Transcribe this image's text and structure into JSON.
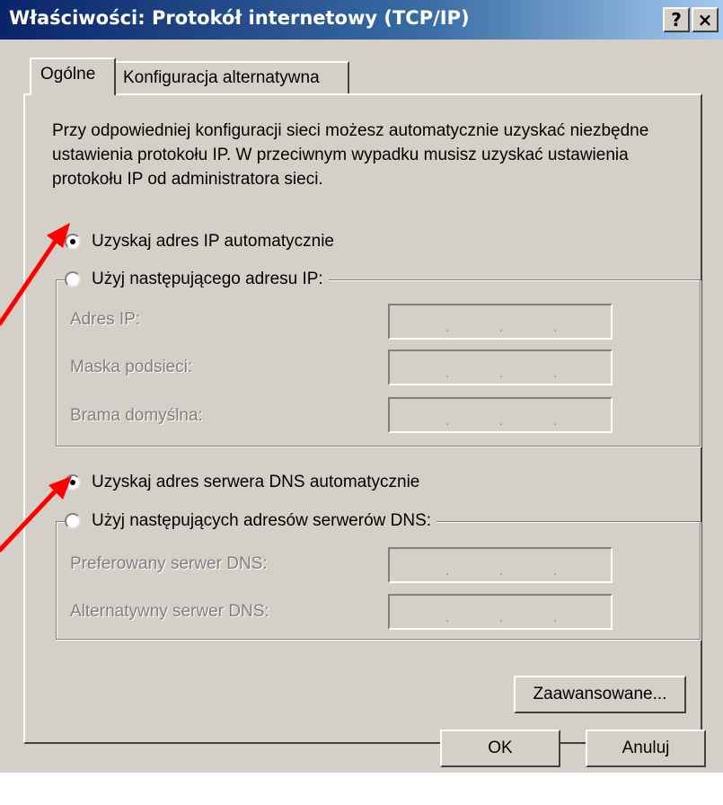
{
  "window": {
    "title": "Właściwości: Protokół internetowy (TCP/IP)",
    "help_button": "?",
    "close_button": "×"
  },
  "tabs": [
    {
      "label": "Ogólne",
      "active": true
    },
    {
      "label": "Konfiguracja alternatywna",
      "active": false
    }
  ],
  "description": "Przy odpowiedniej konfiguracji sieci możesz automatycznie uzyskać niezbędne ustawienia protokołu IP. W przeciwnym wypadku musisz uzyskać ustawienia protokołu IP od administratora sieci.",
  "ip": {
    "auto_label": "Uzyskaj adres IP automatycznie",
    "auto_checked": true,
    "manual_label": "Użyj następującego adresu IP:",
    "fields": [
      {
        "label": "Adres IP:",
        "value": ". . ."
      },
      {
        "label": "Maska podsieci:",
        "value": ". . ."
      },
      {
        "label": "Brama domyślna:",
        "value": ". . ."
      }
    ]
  },
  "dns": {
    "auto_label": "Uzyskaj adres serwera DNS automatycznie",
    "auto_checked": true,
    "manual_label": "Użyj następujących adresów serwerów DNS:",
    "fields": [
      {
        "label": "Preferowany serwer DNS:",
        "value": ". . ."
      },
      {
        "label": "Alternatywny serwer DNS:",
        "value": ". . ."
      }
    ]
  },
  "buttons": {
    "advanced": "Zaawansowane...",
    "ok": "OK",
    "cancel": "Anuluj"
  },
  "colors": {
    "annotation_arrow": "#ff0000",
    "title_bar": "#0a246a",
    "face": "#d4d0c8"
  }
}
